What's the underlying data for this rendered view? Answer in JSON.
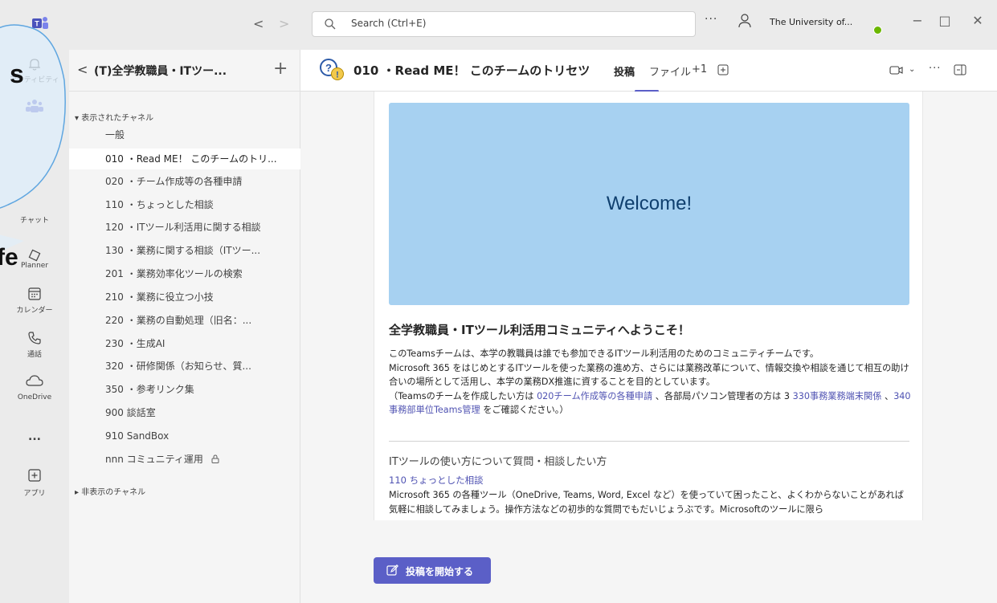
{
  "titlebar": {
    "search_placeholder": "Search (Ctrl+E)",
    "org_name": "The University of..."
  },
  "rail": {
    "items": [
      {
        "label": "アクティビティ",
        "icon": "bell-icon"
      },
      {
        "label": "",
        "icon": "teams-icon"
      },
      {
        "label": "チャット",
        "icon": "chat-icon"
      },
      {
        "label": "Planner",
        "icon": "planner-icon"
      },
      {
        "label": "カレンダー",
        "icon": "calendar-icon"
      },
      {
        "label": "通話",
        "icon": "phone-icon"
      },
      {
        "label": "OneDrive",
        "icon": "cloud-icon"
      },
      {
        "label": "...",
        "icon": "more-icon"
      },
      {
        "label": "アプリ",
        "icon": "apps-icon"
      }
    ]
  },
  "team": {
    "name": "(T)全学教職員・ITツー...",
    "shown_section": "表示されたチャネル",
    "hidden_section": "非表示のチャネル",
    "channels": [
      {
        "label": "一般"
      },
      {
        "label": "010 ・Read ME！ このチームのトリ..."
      },
      {
        "label": "020 ・チーム作成等の各種申請"
      },
      {
        "label": "110 ・ちょっとした相談"
      },
      {
        "label": "120 ・ITツール利活用に関する相談"
      },
      {
        "label": "130 ・業務に関する相談（ITツー..."
      },
      {
        "label": "201 ・業務効率化ツールの検索"
      },
      {
        "label": "210 ・業務に役立つ小技"
      },
      {
        "label": "220 ・業務の自動処理（旧名：..."
      },
      {
        "label": "230 ・生成AI"
      },
      {
        "label": "320 ・研修関係（お知らせ、質..."
      },
      {
        "label": "350 ・参考リンク集"
      },
      {
        "label": "900 談話室"
      },
      {
        "label": "910 SandBox"
      },
      {
        "label": "nnn コミュニティ運用"
      }
    ]
  },
  "channel_header": {
    "title": "010 ・Read ME！ このチームのトリセツ",
    "tabs": [
      "投稿",
      "ファイル",
      "+1"
    ]
  },
  "welcome": {
    "banner": "Welcome!",
    "title": "全学教職員・ITツール利活用コミュニティへようこそ！",
    "p1": "このTeamsチームは、本学の教職員は誰でも参加できるITツール利活用のためのコミュニティチームです。",
    "p2": "Microsoft 365 をはじめとするITツールを使った業務の進め方、さらには業務改革について、情報交換や相談を通じて相互の助け合いの場所として活用し、本学の業務DX推進に資することを目的としています。",
    "p3_a": "（Teamsのチームを作成したい方は ",
    "p3_link1": "020チーム作成等の各種申請",
    "p3_b": " 、各部局パソコン管理者の方は 3 ",
    "p3_link2": "330事務業務端末関係",
    "p3_c": " 、",
    "p3_link3": "340事務部単位Teams管理",
    "p3_d": " をご確認ください。）",
    "sub_head": "ITツールの使い方について質問・相談したい方",
    "sub_link": "110 ちょっとした相談",
    "p4": "Microsoft 365 の各種ツール（OneDrive, Teams, Word, Excel など）を使っていて困ったこと、よくわからないことがあれば気軽に相談してみましょう。操作方法などの初歩的な質問でもだいじょうぶです。Microsoftのツールに限ら"
  },
  "post_button": {
    "label": "投稿を開始する"
  },
  "overlay": {
    "text1": "s",
    "text2": "fe"
  },
  "colors": {
    "accent": "#5b5fc7",
    "banner": "#a7d1f1",
    "link": "#4f52b2",
    "status": "#6bb700"
  }
}
